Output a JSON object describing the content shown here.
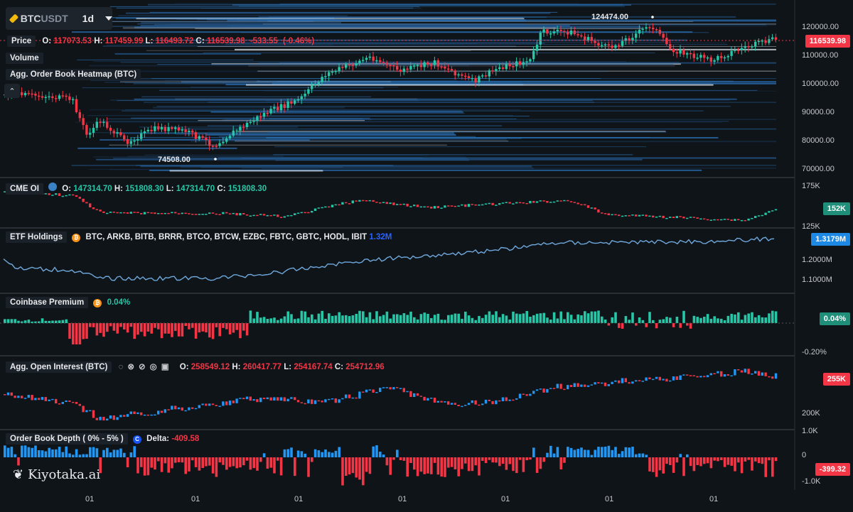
{
  "header": {
    "symbol_base": "BTC",
    "symbol_quote": "USDT",
    "timeframe": "1d"
  },
  "price_legend": {
    "label": "Price",
    "o_label": "O:",
    "o": "117073.53",
    "h_label": "H:",
    "h": "117459.99",
    "l_label": "L:",
    "l": "116493.72",
    "c_label": "C:",
    "c": "116539.98",
    "change": "-533.55",
    "change_pct": "(-0.46%)"
  },
  "indicators": {
    "volume": "Volume",
    "heatmap": "Agg. Order Book Heatmap (BTC)"
  },
  "price_annotations": {
    "high": "124474.00",
    "low": "74508.00"
  },
  "price_axis": {
    "ticks": [
      "120000.00",
      "110000.00",
      "100000.00",
      "90000.00",
      "80000.00",
      "70000.00"
    ],
    "current": "116539.98"
  },
  "cme_oi": {
    "label": "CME OI",
    "o": "147314.70",
    "h": "151808.30",
    "l": "147314.70",
    "c": "151808.30",
    "axis_top": "175K",
    "axis_bottom": "125K",
    "current": "152K"
  },
  "etf": {
    "label": "ETF Holdings",
    "tickers": "BTC, ARKB, BITB, BRRR, BTCO, BTCW, EZBC, FBTC, GBTC, HODL, IBIT",
    "value": "1.32M",
    "axis": [
      "1.2000M",
      "1.1000M"
    ],
    "current": "1.3179M"
  },
  "coinbase": {
    "label": "Coinbase Premium",
    "value": "0.04%",
    "axis_bottom": "-0.20%",
    "current": "0.04%"
  },
  "agg_oi": {
    "label": "Agg. Open Interest (BTC)",
    "o": "258549.12",
    "h": "260417.77",
    "l": "254167.74",
    "c": "254712.96",
    "axis": [
      "200K"
    ],
    "current": "255K"
  },
  "depth": {
    "label": "Order Book Depth ( 0% - 5% )",
    "delta_label": "Delta:",
    "delta": "-409.58",
    "axis": [
      "1.0K",
      "0",
      "-1.0K"
    ],
    "current": "-399.32"
  },
  "x_axis": [
    "01",
    "01",
    "01",
    "01",
    "01",
    "01",
    "01"
  ],
  "watermark": "Kiyotaka.ai",
  "colors": {
    "background": "#0f1419",
    "up": "#26c6a6",
    "down": "#f23645",
    "heatmap": "#2a6fb4",
    "blue_bars": "#2196f3"
  }
}
